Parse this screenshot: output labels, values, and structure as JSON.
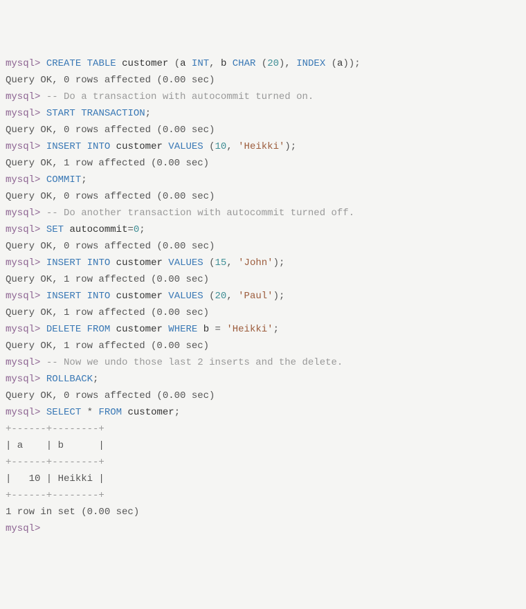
{
  "lines": [
    {
      "parts": [
        {
          "cls": "prompt",
          "t": "mysql>"
        },
        {
          "cls": "punct",
          "t": " "
        },
        {
          "cls": "kw",
          "t": "CREATE"
        },
        {
          "cls": "punct",
          "t": " "
        },
        {
          "cls": "kw",
          "t": "TABLE"
        },
        {
          "cls": "punct",
          "t": " "
        },
        {
          "cls": "ident",
          "t": "customer"
        },
        {
          "cls": "punct",
          "t": " ("
        },
        {
          "cls": "ident",
          "t": "a"
        },
        {
          "cls": "punct",
          "t": " "
        },
        {
          "cls": "kw",
          "t": "INT"
        },
        {
          "cls": "punct",
          "t": ", "
        },
        {
          "cls": "ident",
          "t": "b"
        },
        {
          "cls": "punct",
          "t": " "
        },
        {
          "cls": "kw",
          "t": "CHAR"
        },
        {
          "cls": "punct",
          "t": " ("
        },
        {
          "cls": "num",
          "t": "20"
        },
        {
          "cls": "punct",
          "t": "), "
        },
        {
          "cls": "kw",
          "t": "INDEX"
        },
        {
          "cls": "punct",
          "t": " ("
        },
        {
          "cls": "ident",
          "t": "a"
        },
        {
          "cls": "punct",
          "t": "));"
        }
      ]
    },
    {
      "parts": [
        {
          "cls": "result",
          "t": "Query OK, 0 rows affected (0.00 sec)"
        }
      ]
    },
    {
      "parts": [
        {
          "cls": "prompt",
          "t": "mysql>"
        },
        {
          "cls": "punct",
          "t": " "
        },
        {
          "cls": "comment",
          "t": "-- Do a transaction with autocommit turned on."
        }
      ]
    },
    {
      "parts": [
        {
          "cls": "prompt",
          "t": "mysql>"
        },
        {
          "cls": "punct",
          "t": " "
        },
        {
          "cls": "kw",
          "t": "START"
        },
        {
          "cls": "punct",
          "t": " "
        },
        {
          "cls": "kw",
          "t": "TRANSACTION"
        },
        {
          "cls": "punct",
          "t": ";"
        }
      ]
    },
    {
      "parts": [
        {
          "cls": "result",
          "t": "Query OK, 0 rows affected (0.00 sec)"
        }
      ]
    },
    {
      "parts": [
        {
          "cls": "prompt",
          "t": "mysql>"
        },
        {
          "cls": "punct",
          "t": " "
        },
        {
          "cls": "kw",
          "t": "INSERT"
        },
        {
          "cls": "punct",
          "t": " "
        },
        {
          "cls": "kw",
          "t": "INTO"
        },
        {
          "cls": "punct",
          "t": " "
        },
        {
          "cls": "ident",
          "t": "customer"
        },
        {
          "cls": "punct",
          "t": " "
        },
        {
          "cls": "kw",
          "t": "VALUES"
        },
        {
          "cls": "punct",
          "t": " ("
        },
        {
          "cls": "num",
          "t": "10"
        },
        {
          "cls": "punct",
          "t": ", "
        },
        {
          "cls": "str",
          "t": "'Heikki'"
        },
        {
          "cls": "punct",
          "t": ");"
        }
      ]
    },
    {
      "parts": [
        {
          "cls": "result",
          "t": "Query OK, 1 row affected (0.00 sec)"
        }
      ]
    },
    {
      "parts": [
        {
          "cls": "prompt",
          "t": "mysql>"
        },
        {
          "cls": "punct",
          "t": " "
        },
        {
          "cls": "kw",
          "t": "COMMIT"
        },
        {
          "cls": "punct",
          "t": ";"
        }
      ]
    },
    {
      "parts": [
        {
          "cls": "result",
          "t": "Query OK, 0 rows affected (0.00 sec)"
        }
      ]
    },
    {
      "parts": [
        {
          "cls": "prompt",
          "t": "mysql>"
        },
        {
          "cls": "punct",
          "t": " "
        },
        {
          "cls": "comment",
          "t": "-- Do another transaction with autocommit turned off."
        }
      ]
    },
    {
      "parts": [
        {
          "cls": "prompt",
          "t": "mysql>"
        },
        {
          "cls": "punct",
          "t": " "
        },
        {
          "cls": "kw",
          "t": "SET"
        },
        {
          "cls": "punct",
          "t": " "
        },
        {
          "cls": "ident",
          "t": "autocommit"
        },
        {
          "cls": "punct",
          "t": "="
        },
        {
          "cls": "num",
          "t": "0"
        },
        {
          "cls": "punct",
          "t": ";"
        }
      ]
    },
    {
      "parts": [
        {
          "cls": "result",
          "t": "Query OK, 0 rows affected (0.00 sec)"
        }
      ]
    },
    {
      "parts": [
        {
          "cls": "prompt",
          "t": "mysql>"
        },
        {
          "cls": "punct",
          "t": " "
        },
        {
          "cls": "kw",
          "t": "INSERT"
        },
        {
          "cls": "punct",
          "t": " "
        },
        {
          "cls": "kw",
          "t": "INTO"
        },
        {
          "cls": "punct",
          "t": " "
        },
        {
          "cls": "ident",
          "t": "customer"
        },
        {
          "cls": "punct",
          "t": " "
        },
        {
          "cls": "kw",
          "t": "VALUES"
        },
        {
          "cls": "punct",
          "t": " ("
        },
        {
          "cls": "num",
          "t": "15"
        },
        {
          "cls": "punct",
          "t": ", "
        },
        {
          "cls": "str",
          "t": "'John'"
        },
        {
          "cls": "punct",
          "t": ");"
        }
      ]
    },
    {
      "parts": [
        {
          "cls": "result",
          "t": "Query OK, 1 row affected (0.00 sec)"
        }
      ]
    },
    {
      "parts": [
        {
          "cls": "prompt",
          "t": "mysql>"
        },
        {
          "cls": "punct",
          "t": " "
        },
        {
          "cls": "kw",
          "t": "INSERT"
        },
        {
          "cls": "punct",
          "t": " "
        },
        {
          "cls": "kw",
          "t": "INTO"
        },
        {
          "cls": "punct",
          "t": " "
        },
        {
          "cls": "ident",
          "t": "customer"
        },
        {
          "cls": "punct",
          "t": " "
        },
        {
          "cls": "kw",
          "t": "VALUES"
        },
        {
          "cls": "punct",
          "t": " ("
        },
        {
          "cls": "num",
          "t": "20"
        },
        {
          "cls": "punct",
          "t": ", "
        },
        {
          "cls": "str",
          "t": "'Paul'"
        },
        {
          "cls": "punct",
          "t": ");"
        }
      ]
    },
    {
      "parts": [
        {
          "cls": "result",
          "t": "Query OK, 1 row affected (0.00 sec)"
        }
      ]
    },
    {
      "parts": [
        {
          "cls": "prompt",
          "t": "mysql>"
        },
        {
          "cls": "punct",
          "t": " "
        },
        {
          "cls": "kw",
          "t": "DELETE"
        },
        {
          "cls": "punct",
          "t": " "
        },
        {
          "cls": "kw",
          "t": "FROM"
        },
        {
          "cls": "punct",
          "t": " "
        },
        {
          "cls": "ident",
          "t": "customer"
        },
        {
          "cls": "punct",
          "t": " "
        },
        {
          "cls": "kw",
          "t": "WHERE"
        },
        {
          "cls": "punct",
          "t": " "
        },
        {
          "cls": "ident",
          "t": "b"
        },
        {
          "cls": "punct",
          "t": " = "
        },
        {
          "cls": "str",
          "t": "'Heikki'"
        },
        {
          "cls": "punct",
          "t": ";"
        }
      ]
    },
    {
      "parts": [
        {
          "cls": "result",
          "t": "Query OK, 1 row affected (0.00 sec)"
        }
      ]
    },
    {
      "parts": [
        {
          "cls": "prompt",
          "t": "mysql>"
        },
        {
          "cls": "punct",
          "t": " "
        },
        {
          "cls": "comment",
          "t": "-- Now we undo those last 2 inserts and the delete."
        }
      ]
    },
    {
      "parts": [
        {
          "cls": "prompt",
          "t": "mysql>"
        },
        {
          "cls": "punct",
          "t": " "
        },
        {
          "cls": "kw",
          "t": "ROLLBACK"
        },
        {
          "cls": "punct",
          "t": ";"
        }
      ]
    },
    {
      "parts": [
        {
          "cls": "result",
          "t": "Query OK, 0 rows affected (0.00 sec)"
        }
      ]
    },
    {
      "parts": [
        {
          "cls": "prompt",
          "t": "mysql>"
        },
        {
          "cls": "punct",
          "t": " "
        },
        {
          "cls": "kw",
          "t": "SELECT"
        },
        {
          "cls": "punct",
          "t": " * "
        },
        {
          "cls": "kw",
          "t": "FROM"
        },
        {
          "cls": "punct",
          "t": " "
        },
        {
          "cls": "ident",
          "t": "customer"
        },
        {
          "cls": "punct",
          "t": ";"
        }
      ]
    },
    {
      "parts": [
        {
          "cls": "table-border",
          "t": "+------+--------+"
        }
      ]
    },
    {
      "parts": [
        {
          "cls": "result",
          "t": "| a    | b      |"
        }
      ]
    },
    {
      "parts": [
        {
          "cls": "table-border",
          "t": "+------+--------+"
        }
      ]
    },
    {
      "parts": [
        {
          "cls": "result",
          "t": "|   10 | Heikki |"
        }
      ]
    },
    {
      "parts": [
        {
          "cls": "table-border",
          "t": "+------+--------+"
        }
      ]
    },
    {
      "parts": [
        {
          "cls": "result",
          "t": "1 row in set (0.00 sec)"
        }
      ]
    },
    {
      "parts": [
        {
          "cls": "prompt",
          "t": "mysql>"
        }
      ]
    }
  ]
}
